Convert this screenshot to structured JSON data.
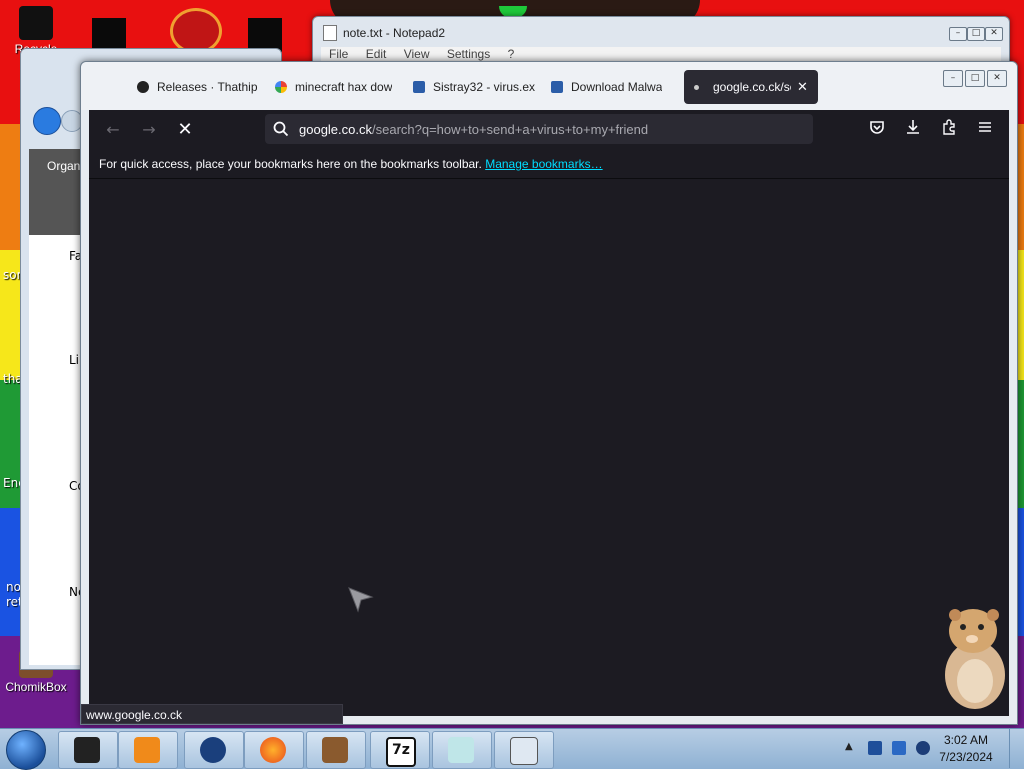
{
  "desktop": {
    "icons": [
      {
        "label": "Recycle",
        "name": "recycle-bin"
      },
      {
        "label": "ChomikBox",
        "name": "chomikbox"
      }
    ],
    "side_fragments": [
      "son",
      "tha",
      "Enc",
      "no",
      "ret"
    ]
  },
  "notepad": {
    "title": "note.txt - Notepad2",
    "menu": [
      "File",
      "Edit",
      "View",
      "Settings",
      "?"
    ]
  },
  "explorer": {
    "toolbar_label": "Organ",
    "nav_fragments": [
      "Fa",
      "Li",
      "Co",
      "Ne"
    ]
  },
  "browser": {
    "tabs": [
      {
        "label": "Releases · Thathip",
        "icon": "github-icon",
        "active": false
      },
      {
        "label": "minecraft hax dow",
        "icon": "google-icon",
        "active": false
      },
      {
        "label": "Sistray32 - virus.ex",
        "icon": "page-icon",
        "active": false
      },
      {
        "label": "Download Malwa",
        "icon": "page-icon",
        "active": false
      },
      {
        "label": "google.co.ck/se",
        "icon": "loading-dot-icon",
        "active": true
      }
    ],
    "url_host": "google.co.ck",
    "url_rest": "/search?q=how+to+send+a+virus+to+my+friend",
    "bookmarks_message": "For quick access, place your bookmarks here on the bookmarks toolbar.",
    "bookmarks_link": "Manage bookmarks…",
    "status_text": "www.google.co.ck"
  },
  "taskbar": {
    "time": "3:02 AM",
    "date": "7/23/2024"
  },
  "colors": {
    "browser_bg": "#1c1b22",
    "link": "#00ddff",
    "taskbar": "#a9c4df"
  }
}
